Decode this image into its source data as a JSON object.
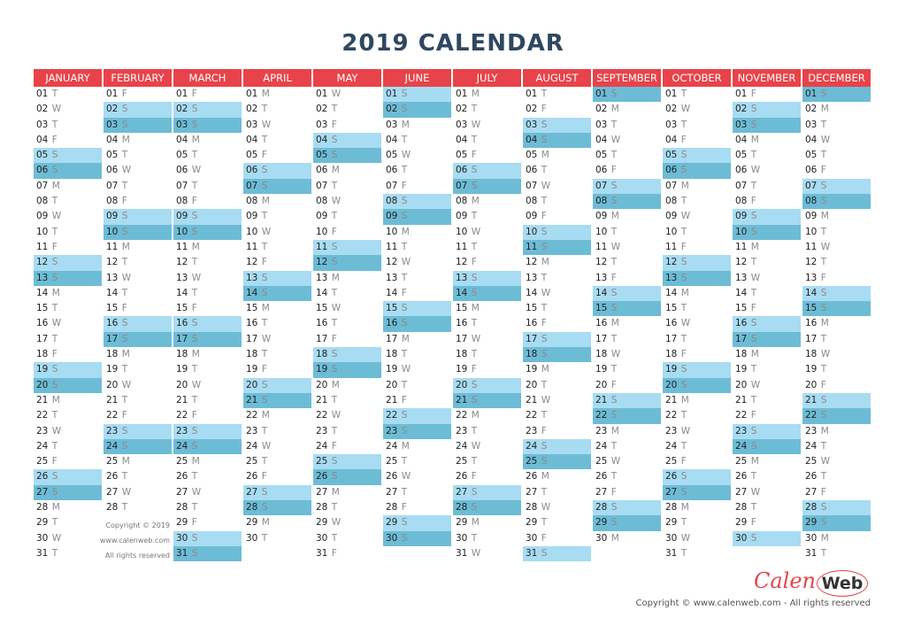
{
  "title": "2019 CALENDAR",
  "year": 2019,
  "weekday_letters": [
    "S",
    "M",
    "T",
    "W",
    "T",
    "F",
    "S"
  ],
  "months": [
    {
      "name": "JANUARY",
      "days": 31
    },
    {
      "name": "FEBRUARY",
      "days": 28
    },
    {
      "name": "MARCH",
      "days": 31
    },
    {
      "name": "APRIL",
      "days": 30
    },
    {
      "name": "MAY",
      "days": 31
    },
    {
      "name": "JUNE",
      "days": 30
    },
    {
      "name": "JULY",
      "days": 31
    },
    {
      "name": "AUGUST",
      "days": 31
    },
    {
      "name": "SEPTEMBER",
      "days": 30
    },
    {
      "name": "OCTOBER",
      "days": 31
    },
    {
      "name": "NOVEMBER",
      "days": 30
    },
    {
      "name": "DECEMBER",
      "days": 31
    }
  ],
  "colors": {
    "header": "#e8434a",
    "saturday": "#a8dcf2",
    "sunday": "#6dbcd6",
    "title": "#2f4760"
  },
  "february_note": {
    "line1": "Copyright  ©  2019",
    "line2": "www.calenweb.com",
    "line3": "All rights reserved"
  },
  "logo": {
    "part1": "Calen",
    "part2": "Web"
  },
  "footer": "Copyright  ©  www.calenweb.com  -  All rights reserved"
}
